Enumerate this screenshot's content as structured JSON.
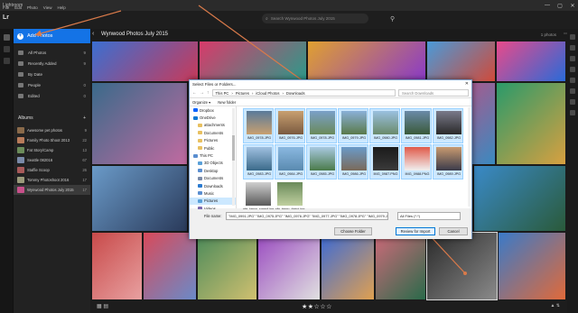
{
  "window": {
    "title": "Lightroom",
    "menu": [
      "File",
      "Edit",
      "Photo",
      "View",
      "Help"
    ],
    "controls": [
      "—",
      "▢",
      "✕"
    ]
  },
  "topbar": {
    "logo": "Lr",
    "search_placeholder": "Search Wynwood Photos July 2015"
  },
  "sidebar": {
    "add_photos": "Add Photos",
    "nav": [
      {
        "label": "All Photos",
        "count": "9"
      },
      {
        "label": "Recently Added",
        "count": "9"
      },
      {
        "label": "By Date",
        "count": ""
      },
      {
        "label": "People",
        "count": "0"
      },
      {
        "label": "Edited",
        "count": "0"
      }
    ],
    "albums_header": "Albums",
    "albums_add": "+",
    "albums": [
      {
        "label": "Awesome pet photos",
        "count": "9",
        "color": "#8a6a4a"
      },
      {
        "label": "Family Photo Shoot 2013",
        "count": "22",
        "color": "#b87b5a"
      },
      {
        "label": "Fat Story/Camp",
        "count": "13",
        "color": "#6b8c5a"
      },
      {
        "label": "Seattle 082016",
        "count": "67",
        "color": "#7a8aa8"
      },
      {
        "label": "Staffie Scoop",
        "count": "26",
        "color": "#a85a5a"
      },
      {
        "label": "Tommy Photoshoot 2016",
        "count": "17",
        "color": "#9a9a7a"
      },
      {
        "label": "Wynwood Photos July 2015",
        "count": "17",
        "color": "#c8508a"
      }
    ]
  },
  "grid": {
    "back": "‹",
    "title": "Wynwood Photos July 2015",
    "count": "1 photos",
    "more": "⋯"
  },
  "bottom": {
    "view_icons": "▦ ▤",
    "stars": "★★☆☆☆",
    "right": "▲ ⇅"
  },
  "dialog": {
    "title": "Select Files or Folders...",
    "close": "✕",
    "breadcrumbs": [
      "This PC",
      "›",
      "Pictures",
      "›",
      "iCloud Photos",
      "›",
      "Downloads"
    ],
    "search_placeholder": "Search Downloads",
    "toolbar": [
      "Organize ▾",
      "New folder"
    ],
    "tree": [
      {
        "label": "Dropbox",
        "color": "#0061fe",
        "sub": false,
        "sel": false
      },
      {
        "label": "OneDrive",
        "color": "#0a78d4",
        "sub": false,
        "sel": false
      },
      {
        "label": "attachments",
        "color": "#e8c060",
        "sub": true,
        "sel": false
      },
      {
        "label": "Documents",
        "color": "#e8c060",
        "sub": true,
        "sel": false
      },
      {
        "label": "Pictures",
        "color": "#e8c060",
        "sub": true,
        "sel": false
      },
      {
        "label": "Public",
        "color": "#e8c060",
        "sub": true,
        "sel": false
      },
      {
        "label": "This PC",
        "color": "#5a8ed0",
        "sub": false,
        "sel": false
      },
      {
        "label": "3D Objects",
        "color": "#5aa0d8",
        "sub": true,
        "sel": false
      },
      {
        "label": "Desktop",
        "color": "#5a8ed0",
        "sub": true,
        "sel": false
      },
      {
        "label": "Documents",
        "color": "#7a8aa8",
        "sub": true,
        "sel": false
      },
      {
        "label": "Downloads",
        "color": "#2a7ad0",
        "sub": true,
        "sel": false
      },
      {
        "label": "Music",
        "color": "#5a8ed0",
        "sub": true,
        "sel": false
      },
      {
        "label": "Pictures",
        "color": "#5aa0d8",
        "sub": true,
        "sel": true
      },
      {
        "label": "Videos",
        "color": "#7a6ab0",
        "sub": true,
        "sel": false
      }
    ],
    "files": [
      {
        "name": "IMG_0978.JPG",
        "c1": "#5a7a9a",
        "c2": "#c8a070",
        "sel": true
      },
      {
        "name": "IMG_0976.JPG",
        "c1": "#c8a070",
        "c2": "#7a5a40",
        "sel": true
      },
      {
        "name": "IMG_0978.JPG",
        "c1": "#7aa0c8",
        "c2": "#6a8a5a",
        "sel": true
      },
      {
        "name": "IMG_0979.JPG",
        "c1": "#8ab0d8",
        "c2": "#5a7a4a",
        "sel": true
      },
      {
        "name": "IMG_0980.JPG",
        "c1": "#9ac0e0",
        "c2": "#6a8a6a",
        "sel": true
      },
      {
        "name": "IMG_0981.JPG",
        "c1": "#6a8aa8",
        "c2": "#3a5a3a",
        "sel": true
      },
      {
        "name": "IMG_0982.JPG",
        "c1": "#7a7a8a",
        "c2": "#2a2a2a",
        "sel": true
      },
      {
        "name": "IMG_0983.JPG",
        "c1": "#a0c0e0",
        "c2": "#3a6a8a",
        "sel": true
      },
      {
        "name": "IMG_0984.JPG",
        "c1": "#8ab8e0",
        "c2": "#5a8ab0",
        "sel": true
      },
      {
        "name": "IMG_0985.JPG",
        "c1": "#a8c8e0",
        "c2": "#4a7a4a",
        "sel": true
      },
      {
        "name": "IMG_0986.JPG",
        "c1": "#6a9ac8",
        "c2": "#7a6a5a",
        "sel": true
      },
      {
        "name": "IMG_0987.PNG",
        "c1": "#1a1a1a",
        "c2": "#3a3a3a",
        "sel": true
      },
      {
        "name": "IMG_0988.PNG",
        "c1": "#e05a4a",
        "c2": "#f0f0f0",
        "sel": true
      },
      {
        "name": "IMG_0989.JPG",
        "c1": "#c89a70",
        "c2": "#3a3a4a",
        "sel": true
      },
      {
        "name": "pfg_temp_samsf.jpg",
        "c1": "#d0d0d0",
        "c2": "#5a5a5a",
        "sel": false
      },
      {
        "name": "pfg_temp_tjakcj.jpg",
        "c1": "#6a8a5a",
        "c2": "#c0d0a0",
        "sel": false
      }
    ],
    "filename_label": "File name:",
    "filename_value": "\"IMG_0991.JPG\" \"IMG_0975.JPG\" \"IMG_0976.JPG\" \"IMG_0977.JPG\" \"IMG_0978.JPG\" \"IMG_0979.JPG\" \"IMG_",
    "filetype": "All Files (*.*)",
    "choose_folder": "Choose Folder",
    "review": "Review for Import",
    "cancel": "Cancel"
  }
}
